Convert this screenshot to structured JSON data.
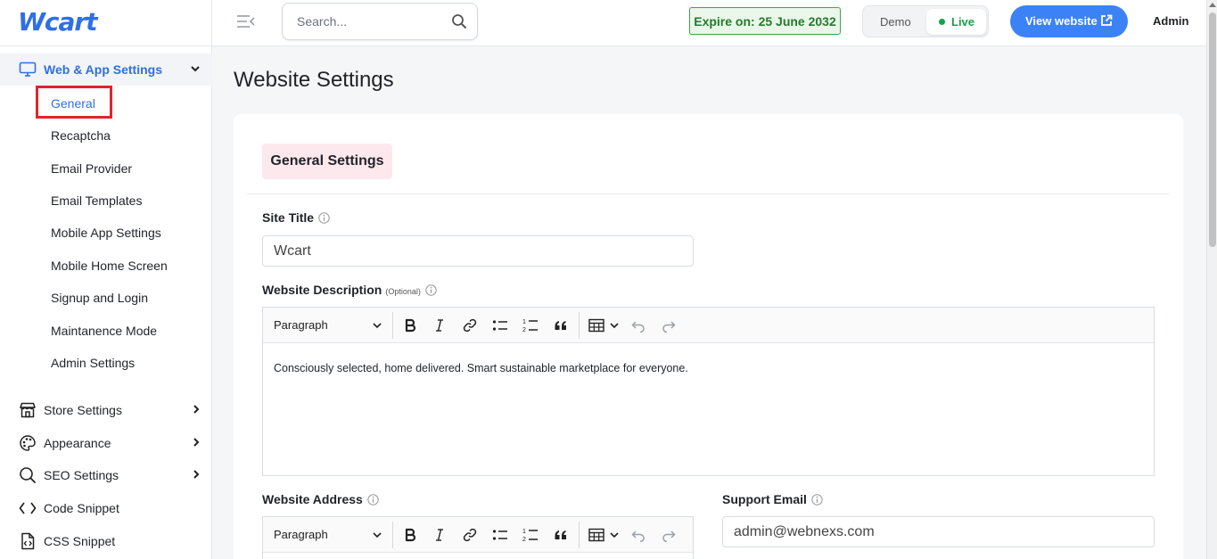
{
  "app": {
    "logo": "Wcart"
  },
  "sidebar": {
    "group": {
      "label": "Web & App Settings"
    },
    "sub_items": [
      {
        "label": "General",
        "active": true
      },
      {
        "label": "Recaptcha"
      },
      {
        "label": "Email Provider"
      },
      {
        "label": "Email Templates"
      },
      {
        "label": "Mobile App Settings"
      },
      {
        "label": "Mobile Home Screen"
      },
      {
        "label": "Signup and Login"
      },
      {
        "label": "Maintanence Mode"
      },
      {
        "label": "Admin Settings"
      }
    ],
    "main_items": [
      {
        "label": "Store Settings",
        "icon": "store-icon",
        "has_children": true
      },
      {
        "label": "Appearance",
        "icon": "palette-icon",
        "has_children": true
      },
      {
        "label": "SEO Settings",
        "icon": "search-icon",
        "has_children": true
      },
      {
        "label": "Code Snippet",
        "icon": "code-icon",
        "has_children": false
      },
      {
        "label": "CSS Snippet",
        "icon": "file-code-icon",
        "has_children": false
      }
    ]
  },
  "topbar": {
    "search_placeholder": "Search...",
    "expire": "Expire on: 25 June 2032",
    "mode_demo": "Demo",
    "mode_live": "Live",
    "view_website": "View website",
    "user": "Admin"
  },
  "page": {
    "title": "Website Settings",
    "section": "General Settings",
    "site_title_label": "Site Title",
    "site_title_value": "Wcart",
    "description_label": "Website Description",
    "description_optional": "(Optional)",
    "description_text": "Consciously selected, home delivered. Smart sustainable marketplace for everyone.",
    "editor_block_format": "Paragraph",
    "address_label": "Website Address",
    "support_email_label": "Support Email",
    "support_email_value": "admin@webnexs.com"
  },
  "colors": {
    "accent": "#2f6fe4",
    "live": "#16a34a",
    "expire_border": "#3ea44a",
    "section_bg": "#fde8ee",
    "highlight": "#e0242b"
  }
}
